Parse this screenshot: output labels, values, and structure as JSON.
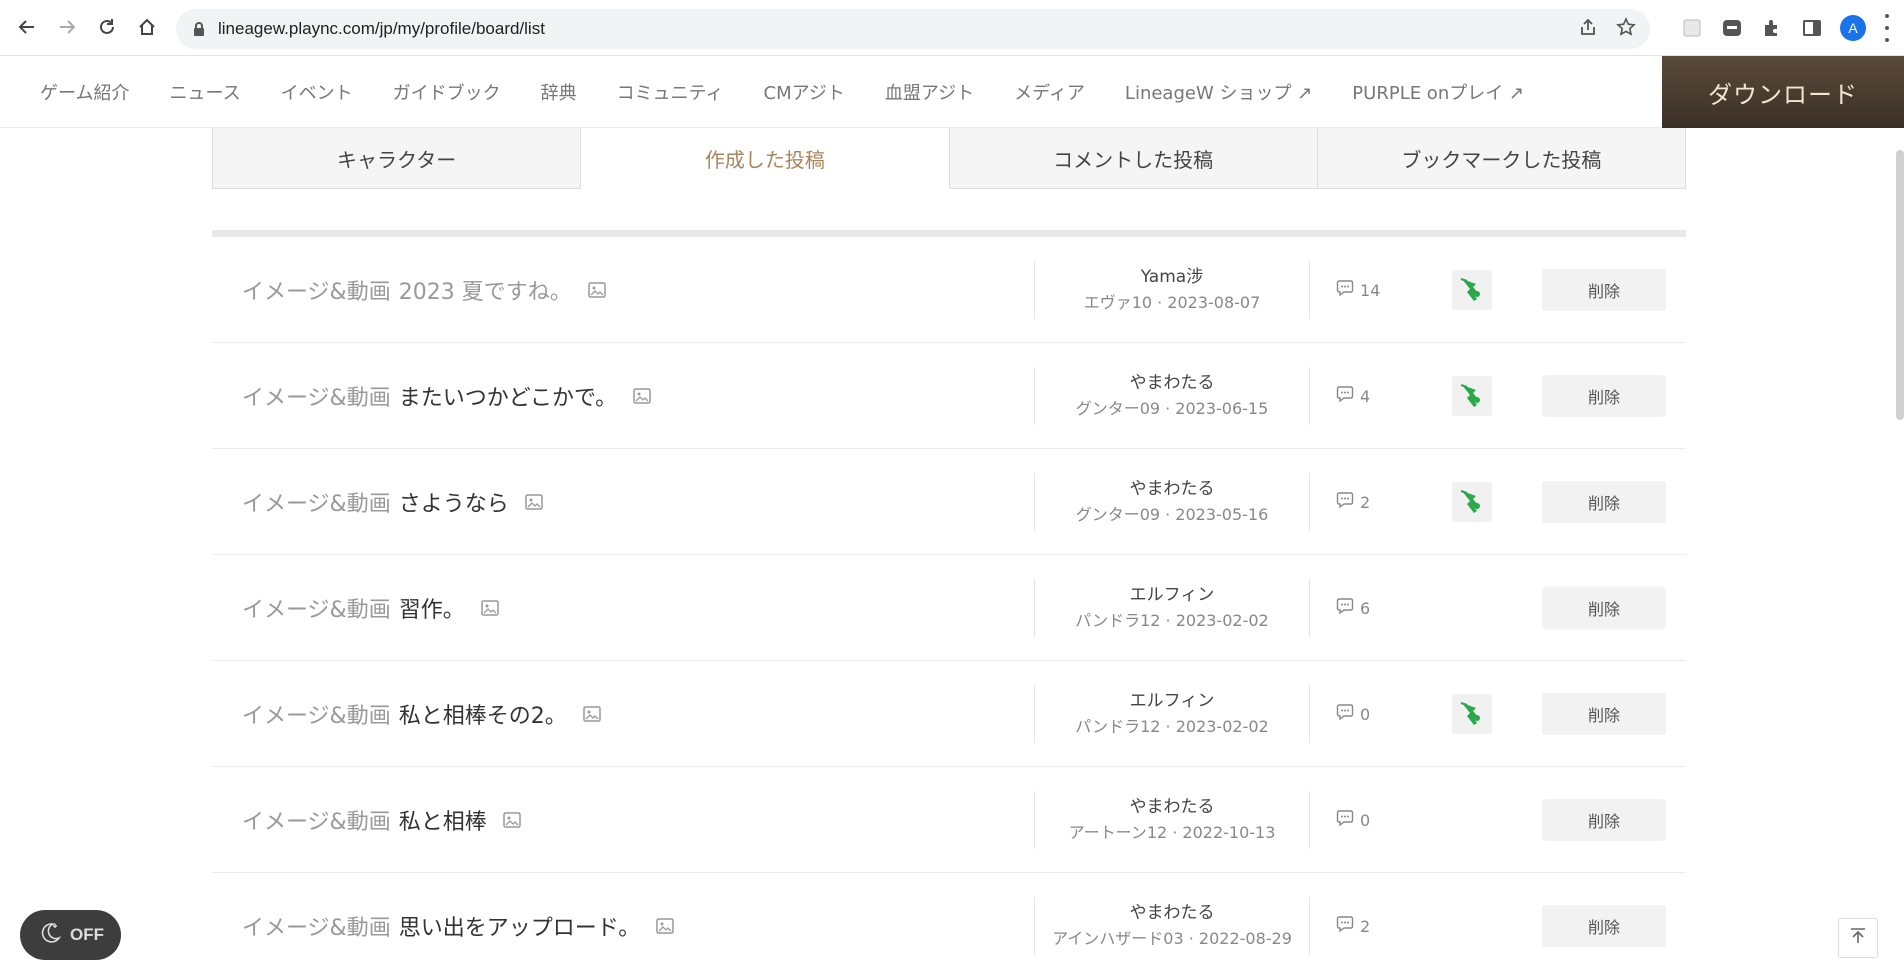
{
  "browser": {
    "url": "lineagew.plaync.com/jp/my/profile/board/list",
    "avatar_letter": "A"
  },
  "site_nav": {
    "items": [
      "ゲーム紹介",
      "ニュース",
      "イベント",
      "ガイドブック",
      "辞典",
      "コミュニティ",
      "CMアジト",
      "血盟アジト",
      "メディア",
      "LineageW ショップ ↗",
      "PURPLE onプレイ ↗"
    ],
    "download_label": "ダウンロード"
  },
  "tabs": [
    {
      "label": "キャラクター",
      "active": false
    },
    {
      "label": "作成した投稿",
      "active": true
    },
    {
      "label": "コメントした投稿",
      "active": false
    },
    {
      "label": "ブックマークした投稿",
      "active": false
    }
  ],
  "posts": [
    {
      "category": "イメージ&動画",
      "title": "2023 夏ですね。",
      "read": true,
      "author": "Yama涉",
      "meta": "エヴァ10 · 2023-08-07",
      "comments": "14",
      "badge": true,
      "delete_label": "削除"
    },
    {
      "category": "イメージ&動画",
      "title": "またいつかどこかで。",
      "read": false,
      "author": "やまわたる",
      "meta": "グンター09 · 2023-06-15",
      "comments": "4",
      "badge": true,
      "delete_label": "削除"
    },
    {
      "category": "イメージ&動画",
      "title": "さようなら",
      "read": false,
      "author": "やまわたる",
      "meta": "グンター09 · 2023-05-16",
      "comments": "2",
      "badge": true,
      "delete_label": "削除"
    },
    {
      "category": "イメージ&動画",
      "title": "習作。",
      "read": false,
      "author": "エルフィン",
      "meta": "パンドラ12 · 2023-02-02",
      "comments": "6",
      "badge": false,
      "delete_label": "削除"
    },
    {
      "category": "イメージ&動画",
      "title": "私と相棒その2。",
      "read": false,
      "author": "エルフィン",
      "meta": "パンドラ12 · 2023-02-02",
      "comments": "0",
      "badge": true,
      "delete_label": "削除"
    },
    {
      "category": "イメージ&動画",
      "title": "私と相棒",
      "read": false,
      "author": "やまわたる",
      "meta": "アートーン12 · 2022-10-13",
      "comments": "0",
      "badge": false,
      "delete_label": "削除"
    },
    {
      "category": "イメージ&動画",
      "title": "思い出をアップロード。",
      "read": false,
      "author": "やまわたる",
      "meta": "アインハザード03 · 2022-08-29",
      "comments": "2",
      "badge": false,
      "delete_label": "削除"
    }
  ],
  "dark_toggle": {
    "label": "OFF"
  },
  "colors": {
    "accent": "#a8865d",
    "badge_green": "#2aa84a",
    "download_bg": "#4a3c2f"
  }
}
